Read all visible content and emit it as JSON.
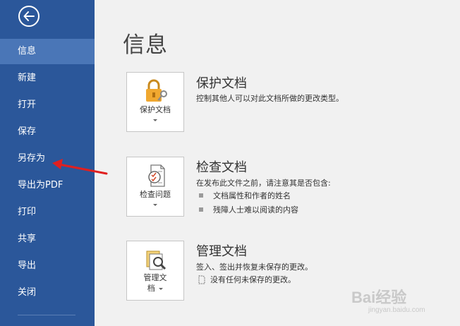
{
  "sidebar": {
    "items": [
      {
        "label": "信息",
        "active": true
      },
      {
        "label": "新建"
      },
      {
        "label": "打开"
      },
      {
        "label": "保存"
      },
      {
        "label": "另存为"
      },
      {
        "label": "导出为PDF"
      },
      {
        "label": "打印"
      },
      {
        "label": "共享"
      },
      {
        "label": "导出"
      },
      {
        "label": "关闭"
      }
    ],
    "back_icon": "back-arrow-circle-icon"
  },
  "main": {
    "title": "信息",
    "sections": [
      {
        "button_label": "保护文档",
        "button_icon": "lock-key-icon",
        "title": "保护文档",
        "description": "控制其他人可以对此文档所做的更改类型。"
      },
      {
        "button_label": "检查问题",
        "button_icon": "document-check-icon",
        "title": "检查文档",
        "description": "在发布此文件之前，请注意其是否包含:",
        "bullets": [
          "文档属性和作者的姓名",
          "残障人士难以阅读的内容"
        ]
      },
      {
        "button_label_line1": "管理文",
        "button_label_line2": "档",
        "button_icon": "manage-documents-icon",
        "title": "管理文档",
        "description": "签入、签出并恢复未保存的更改。",
        "note": "没有任何未保存的更改。"
      }
    ]
  },
  "annotation": {
    "color": "#e02020"
  },
  "watermark": {
    "text": "Bai经验",
    "sub": "jingyan.baidu.com"
  },
  "colors": {
    "sidebar": "#2b579a",
    "sidebar_active": "#4a76b7",
    "background": "#f1f1f1",
    "lock": "#f0a830"
  }
}
